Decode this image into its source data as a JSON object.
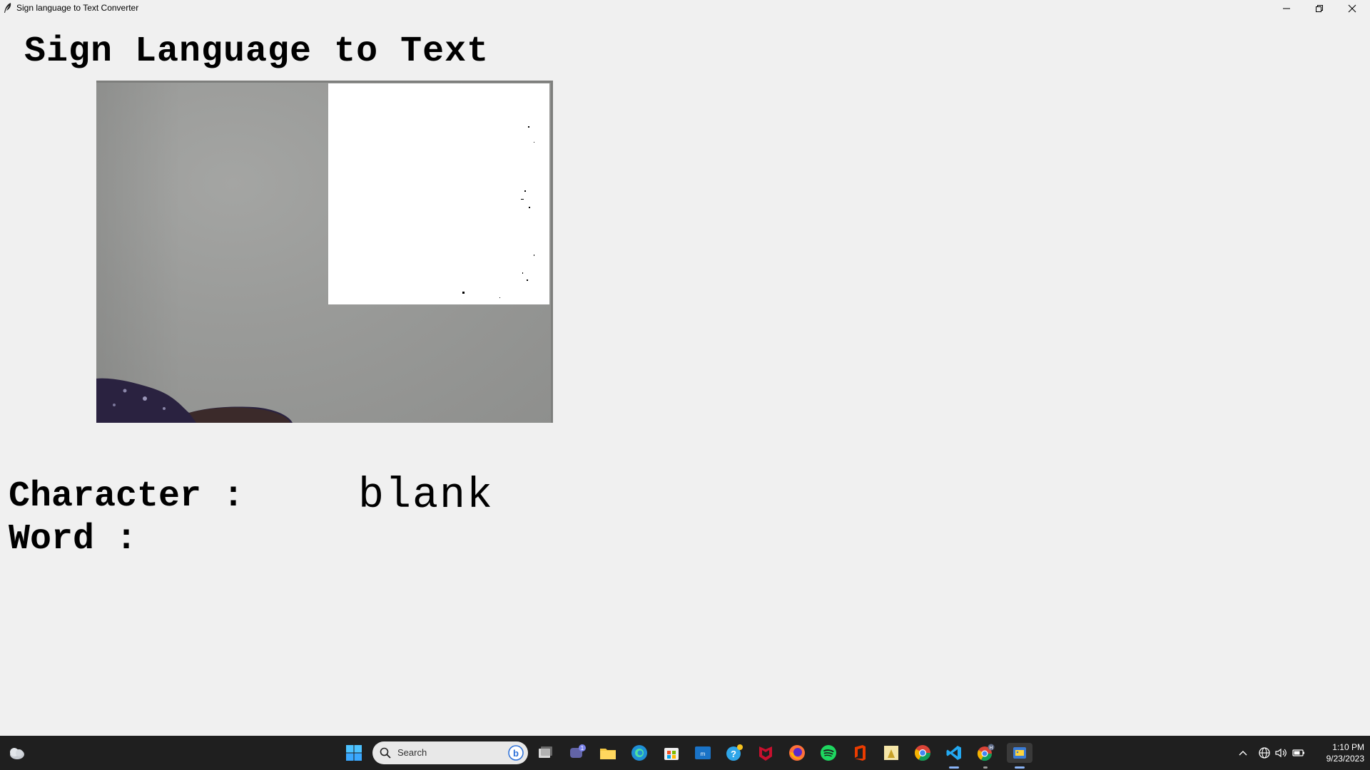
{
  "window": {
    "title": "Sign language to Text Converter"
  },
  "app": {
    "heading": "Sign Language to Text",
    "character_label": "Character :",
    "character_value": "blank",
    "word_label": "Word :",
    "word_value": ""
  },
  "taskbar": {
    "search_placeholder": "Search",
    "time": "1:10 PM",
    "date": "9/23/2023",
    "teams_badge": "1",
    "profile_badge": "H"
  },
  "colors": {
    "background": "#f0f0f0",
    "taskbar": "#1f1f1f",
    "roi": "#ffffff"
  }
}
